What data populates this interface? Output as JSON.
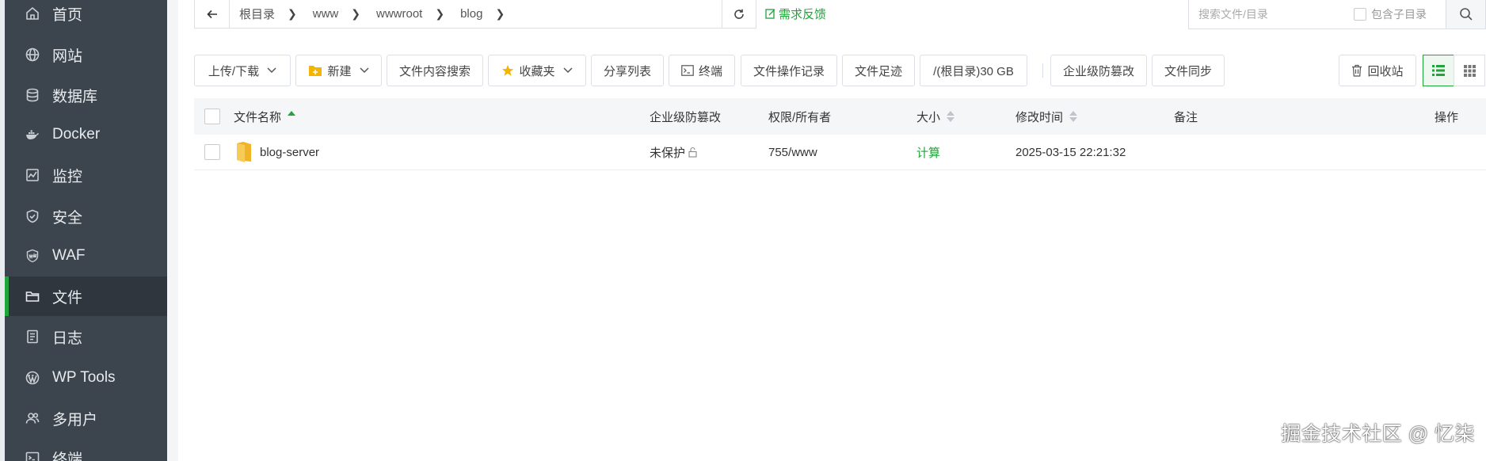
{
  "sidebar": {
    "items": [
      {
        "label": "首页",
        "icon": "home-icon"
      },
      {
        "label": "网站",
        "icon": "globe-icon"
      },
      {
        "label": "数据库",
        "icon": "database-icon"
      },
      {
        "label": "Docker",
        "icon": "docker-icon"
      },
      {
        "label": "监控",
        "icon": "monitor-icon"
      },
      {
        "label": "安全",
        "icon": "shield-icon"
      },
      {
        "label": "WAF",
        "icon": "waf-icon"
      },
      {
        "label": "文件",
        "icon": "folder-icon",
        "active": true
      },
      {
        "label": "日志",
        "icon": "log-icon"
      },
      {
        "label": "WP Tools",
        "icon": "wordpress-icon"
      },
      {
        "label": "多用户",
        "icon": "users-icon"
      },
      {
        "label": "终端",
        "icon": "terminal-icon"
      }
    ]
  },
  "path": {
    "crumbs": [
      "根目录",
      "www",
      "wwwroot",
      "blog"
    ]
  },
  "feedback_label": "需求反馈",
  "search": {
    "placeholder": "搜索文件/目录",
    "include_sub_label": "包含子目录"
  },
  "toolbar": {
    "upload": "上传/下载",
    "new": "新建",
    "content_search": "文件内容搜索",
    "favorites": "收藏夹",
    "share_list": "分享列表",
    "terminal": "终端",
    "op_log": "文件操作记录",
    "footprint": "文件足迹",
    "disk": "/(根目录)30 GB",
    "tamper": "企业级防篡改",
    "sync": "文件同步",
    "recycle": "回收站"
  },
  "table": {
    "headers": {
      "name": "文件名称",
      "tamper": "企业级防篡改",
      "perm": "权限/所有者",
      "size": "大小",
      "mtime": "修改时间",
      "note": "备注",
      "action": "操作"
    },
    "rows": [
      {
        "name": "blog-server",
        "tamper": "未保护",
        "perm": "755/www",
        "size": "计算",
        "mtime": "2025-03-15 22:21:32",
        "note": ""
      }
    ]
  },
  "watermark": "掘金技术社区 @ 忆柒",
  "colors": {
    "accent": "#20a53a",
    "sidebar_bg": "#3c444d",
    "folder": "#f5c044"
  }
}
